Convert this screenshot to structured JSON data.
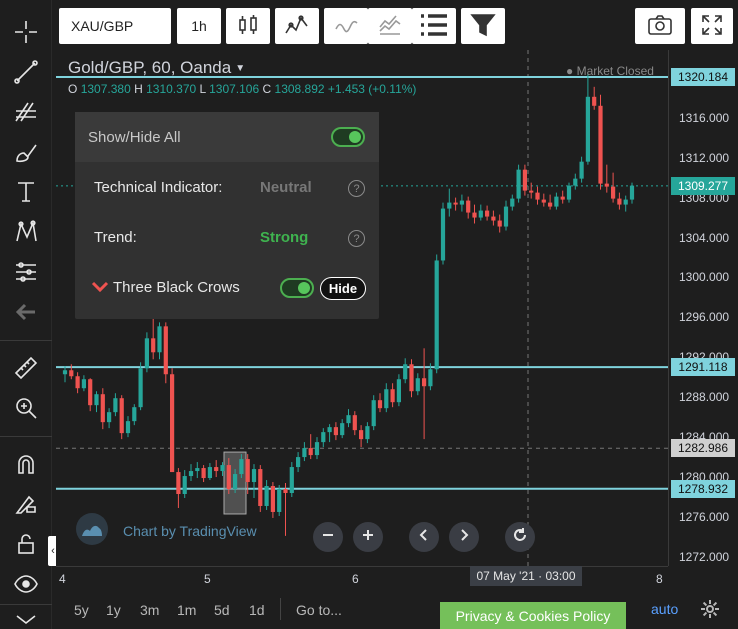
{
  "symbol_search": {
    "value": "XAU/GBP"
  },
  "interval": {
    "value": "1h"
  },
  "header": {
    "title": "Gold/GBP, 60, Oanda",
    "market_status": "Market Closed",
    "ohlc": {
      "o_label": "O",
      "o": "1307.380",
      "h_label": "H",
      "h": "1310.370",
      "l_label": "L",
      "l": "1307.106",
      "c_label": "C",
      "c": "1308.892",
      "change": "+1.453 (+0.11%)"
    }
  },
  "panel": {
    "show_hide_all": "Show/Hide All",
    "technical_label": "Technical Indicator:",
    "technical_value": "Neutral",
    "trend_label": "Trend:",
    "trend_value": "Strong",
    "pattern_label": "Three Black Crows",
    "hide_button": "Hide",
    "help_glyph": "?"
  },
  "price_axis": {
    "ticks": [
      "1316.000",
      "1312.000",
      "1308.000",
      "1304.000",
      "1300.000",
      "1296.000",
      "1292.000",
      "1288.000",
      "1284.000",
      "1280.000",
      "1276.000",
      "1272.000"
    ],
    "labels": {
      "top_line": "1320.184",
      "last_price": "1309.277",
      "line_2": "1291.118",
      "crosshair": "1282.986",
      "line_3": "1278.932"
    }
  },
  "time_axis": {
    "ticks": [
      "4",
      "5",
      "6",
      "8"
    ],
    "crosshair_label": "07 May '21 · 03:00"
  },
  "bottom": {
    "ranges": [
      "5y",
      "1y",
      "3m",
      "1m",
      "5d",
      "1d"
    ],
    "goto": "Go to...",
    "privacy": "Privacy & Cookies Policy",
    "auto": "auto"
  },
  "watermark": "Chart by TradingView",
  "colors": {
    "up": "#26a69a",
    "down": "#ef5350",
    "hline": "#7fd3dd",
    "accent_green": "#4caf50",
    "privacy_bg": "#75c05a"
  },
  "chart_data": {
    "type": "candlestick",
    "price_range": [
      1270.0,
      1320.184
    ],
    "horizontal_lines": [
      1320.184,
      1291.118,
      1278.932
    ],
    "crosshair_price": 1282.986,
    "candles": [
      [
        1290.4,
        1291.2,
        1289.6,
        1290.8
      ],
      [
        1290.8,
        1291.4,
        1289.9,
        1290.2
      ],
      [
        1290.2,
        1290.6,
        1288.5,
        1289.0
      ],
      [
        1289.0,
        1290.3,
        1288.7,
        1289.9
      ],
      [
        1289.9,
        1290.0,
        1286.7,
        1287.3
      ],
      [
        1287.3,
        1288.7,
        1286.6,
        1288.4
      ],
      [
        1288.4,
        1289.0,
        1284.9,
        1285.6
      ],
      [
        1285.6,
        1287.0,
        1285.0,
        1286.6
      ],
      [
        1286.6,
        1288.5,
        1286.2,
        1288.0
      ],
      [
        1288.0,
        1288.3,
        1283.9,
        1284.5
      ],
      [
        1284.5,
        1286.2,
        1284.1,
        1285.7
      ],
      [
        1285.7,
        1287.4,
        1285.3,
        1287.1
      ],
      [
        1287.1,
        1291.6,
        1286.8,
        1291.0
      ],
      [
        1291.0,
        1294.6,
        1290.6,
        1294.0
      ],
      [
        1294.0,
        1297.1,
        1291.9,
        1292.6
      ],
      [
        1292.6,
        1295.6,
        1291.9,
        1295.2
      ],
      [
        1295.2,
        1295.6,
        1289.5,
        1290.4
      ],
      [
        1290.4,
        1291.0,
        1280.6,
        1280.6
      ],
      [
        1280.6,
        1281.0,
        1277.0,
        1278.4
      ],
      [
        1278.4,
        1280.8,
        1278.0,
        1280.2
      ],
      [
        1280.2,
        1281.4,
        1279.7,
        1280.7
      ],
      [
        1280.7,
        1281.6,
        1280.0,
        1281.0
      ],
      [
        1281.0,
        1281.3,
        1279.6,
        1280.0
      ],
      [
        1280.0,
        1281.5,
        1279.8,
        1281.1
      ],
      [
        1281.1,
        1281.8,
        1280.1,
        1280.7
      ],
      [
        1280.7,
        1281.6,
        1280.2,
        1281.3
      ],
      [
        1281.3,
        1282.0,
        1278.4,
        1278.9
      ],
      [
        1278.9,
        1280.9,
        1278.5,
        1280.4
      ],
      [
        1280.4,
        1282.4,
        1280.0,
        1281.9
      ],
      [
        1281.9,
        1282.4,
        1278.4,
        1279.6
      ],
      [
        1279.6,
        1281.4,
        1278.0,
        1280.9
      ],
      [
        1280.9,
        1281.3,
        1276.6,
        1277.2
      ],
      [
        1277.2,
        1279.8,
        1276.8,
        1279.2
      ],
      [
        1279.2,
        1279.6,
        1276.0,
        1276.6
      ],
      [
        1276.6,
        1279.3,
        1276.2,
        1278.9
      ],
      [
        1278.9,
        1279.5,
        1274.2,
        1278.5
      ],
      [
        1278.5,
        1281.6,
        1278.1,
        1281.1
      ],
      [
        1281.1,
        1282.6,
        1280.6,
        1282.1
      ],
      [
        1282.1,
        1283.6,
        1281.7,
        1283.0
      ],
      [
        1283.0,
        1284.4,
        1281.9,
        1282.3
      ],
      [
        1282.3,
        1284.1,
        1281.9,
        1283.6
      ],
      [
        1283.6,
        1285.0,
        1283.1,
        1284.6
      ],
      [
        1284.6,
        1285.4,
        1283.6,
        1285.1
      ],
      [
        1285.1,
        1285.6,
        1283.8,
        1284.3
      ],
      [
        1284.3,
        1285.9,
        1284.0,
        1285.5
      ],
      [
        1285.5,
        1286.9,
        1285.1,
        1286.3
      ],
      [
        1286.3,
        1286.7,
        1284.3,
        1284.8
      ],
      [
        1284.8,
        1285.3,
        1283.1,
        1283.9
      ],
      [
        1283.9,
        1285.6,
        1283.5,
        1285.2
      ],
      [
        1285.2,
        1288.3,
        1284.8,
        1287.8
      ],
      [
        1287.8,
        1288.5,
        1286.6,
        1287.0
      ],
      [
        1287.0,
        1289.5,
        1286.6,
        1288.9
      ],
      [
        1288.9,
        1289.5,
        1287.1,
        1287.6
      ],
      [
        1287.6,
        1290.4,
        1287.2,
        1289.9
      ],
      [
        1289.9,
        1292.0,
        1289.5,
        1291.4
      ],
      [
        1291.4,
        1291.9,
        1288.1,
        1288.7
      ],
      [
        1288.7,
        1290.5,
        1288.3,
        1290.0
      ],
      [
        1290.0,
        1293.0,
        1283.9,
        1289.2
      ],
      [
        1289.2,
        1291.5,
        1288.8,
        1290.9
      ],
      [
        1290.9,
        1302.4,
        1290.5,
        1301.8
      ],
      [
        1301.8,
        1307.6,
        1301.4,
        1307.0
      ],
      [
        1307.0,
        1309.0,
        1306.2,
        1307.6
      ],
      [
        1307.6,
        1308.1,
        1306.8,
        1307.4
      ],
      [
        1307.4,
        1308.4,
        1306.7,
        1307.8
      ],
      [
        1307.8,
        1308.2,
        1306.0,
        1306.6
      ],
      [
        1306.6,
        1307.4,
        1305.5,
        1306.1
      ],
      [
        1306.1,
        1307.4,
        1305.8,
        1306.8
      ],
      [
        1306.8,
        1307.3,
        1305.8,
        1306.2
      ],
      [
        1306.2,
        1306.8,
        1305.3,
        1305.8
      ],
      [
        1305.8,
        1306.4,
        1304.6,
        1305.2
      ],
      [
        1305.2,
        1307.8,
        1304.8,
        1307.2
      ],
      [
        1307.2,
        1308.4,
        1306.8,
        1308.0
      ],
      [
        1308.0,
        1311.4,
        1307.6,
        1310.9
      ],
      [
        1310.9,
        1311.4,
        1308.3,
        1308.8
      ],
      [
        1308.8,
        1309.6,
        1308.0,
        1308.6
      ],
      [
        1308.6,
        1309.2,
        1307.4,
        1307.9
      ],
      [
        1307.9,
        1308.5,
        1307.2,
        1307.6
      ],
      [
        1307.6,
        1308.4,
        1306.9,
        1307.2
      ],
      [
        1307.2,
        1308.6,
        1306.9,
        1308.2
      ],
      [
        1308.2,
        1308.8,
        1307.5,
        1307.9
      ],
      [
        1307.9,
        1309.6,
        1307.6,
        1309.3
      ],
      [
        1309.3,
        1310.5,
        1308.9,
        1310.0
      ],
      [
        1310.0,
        1312.2,
        1309.6,
        1311.7
      ],
      [
        1311.7,
        1320.5,
        1311.4,
        1318.2
      ],
      [
        1318.2,
        1319.2,
        1316.9,
        1317.3
      ],
      [
        1317.3,
        1318.4,
        1308.9,
        1309.5
      ],
      [
        1309.5,
        1311.4,
        1308.6,
        1309.2
      ],
      [
        1309.2,
        1310.6,
        1307.6,
        1308.0
      ],
      [
        1308.0,
        1308.6,
        1306.9,
        1307.4
      ],
      [
        1307.4,
        1308.3,
        1306.7,
        1307.9
      ],
      [
        1307.9,
        1309.6,
        1307.5,
        1309.3
      ]
    ]
  }
}
